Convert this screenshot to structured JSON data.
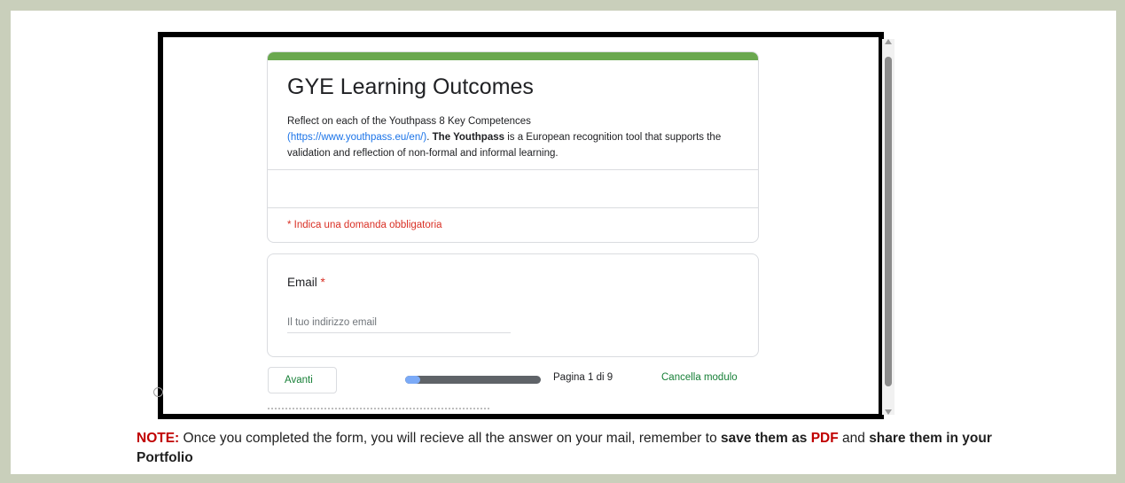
{
  "form": {
    "title": "GYE Learning Outcomes",
    "description_line1": "Reflect on each of the Youthpass 8 Key Competences",
    "description_link": "(https://www.youthpass.eu/en/)",
    "description_link_suffix": ". ",
    "description_bold": "The Youthpass",
    "description_rest": " is a European recognition tool that supports the validation and reflection of non-formal and informal learning.",
    "required_note": "* Indica una domanda obbligatoria",
    "accent_color": "#6aa84f"
  },
  "email_question": {
    "label": "Email",
    "required_marker": "*",
    "placeholder": "Il tuo indirizzo email",
    "value": ""
  },
  "footer": {
    "next_label": "Avanti",
    "progress_fraction": 0.111,
    "page_indicator": "Pagina 1 di 9",
    "clear_label": "Cancella modulo"
  },
  "note": {
    "prefix": "NOTE:",
    "text1": " Once you completed the form, you will recieve all the answer on your mail, remember to ",
    "bold1": "save them as",
    "pdf": " PDF",
    "text2": " and ",
    "bold2": "share them in your Portfolio"
  }
}
